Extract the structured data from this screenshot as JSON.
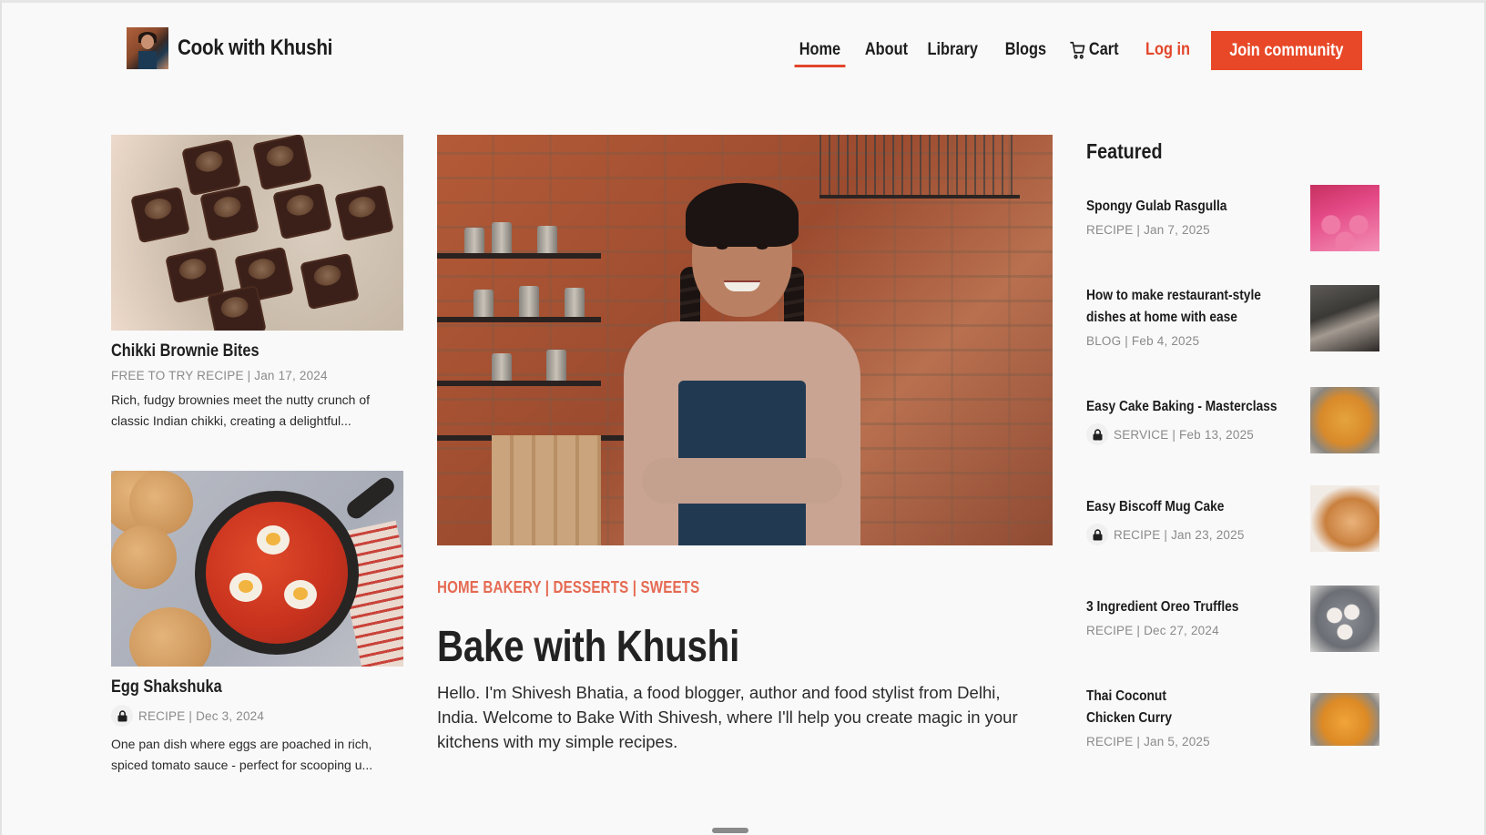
{
  "brand": {
    "name": "Cook with Khushi",
    "logo_icon": "chef-portrait"
  },
  "nav": {
    "items": [
      {
        "label": "Home",
        "active": true
      },
      {
        "label": "About"
      },
      {
        "label": "Library"
      },
      {
        "label": "Blogs"
      }
    ],
    "cart_label": "Cart",
    "cart_icon": "shopping-cart-icon",
    "login_label": "Log in",
    "join_label": "Join community"
  },
  "colors": {
    "accent": "#e84827",
    "tag": "#e56a52",
    "meta": "#8a8a8a",
    "background": "#f9f9f9"
  },
  "left_cards": [
    {
      "title": "Chikki Brownie Bites",
      "meta": "FREE TO TRY RECIPE | Jan 17, 2024",
      "locked": false,
      "description": "Rich, fudgy brownies meet the nutty crunch of classic Indian chikki, creating a delightful...",
      "image": "chikki brownie bites on a plate"
    },
    {
      "title": "Egg Shakshuka",
      "meta": "RECIPE | Dec 3, 2024",
      "locked": true,
      "description": "One pan dish where eggs are poached in rich, spiced tomato sauce - perfect for scooping u...",
      "image": "egg shakshuka in cast iron pan"
    }
  ],
  "hero": {
    "image": "Khushi smiling in kitchen with brick wall",
    "tags": "HOME BAKERY | DESSERTS | SWEETS",
    "title": "Bake with Khushi",
    "description": "Hello. I'm Shivesh Bhatia, a food blogger, author and food stylist from Delhi, India. Welcome to Bake With Shivesh, where I'll help you create magic in your kitchens with my simple recipes."
  },
  "featured": {
    "heading": "Featured",
    "items": [
      {
        "title": "Spongy Gulab Rasgulla",
        "meta": "RECIPE | Jan 7, 2025",
        "locked": false,
        "thumb": "rasgulla"
      },
      {
        "title": "How to make restaurant-style dishes at home with ease",
        "meta": "BLOG | Feb 4, 2025",
        "locked": false,
        "thumb": "cooking"
      },
      {
        "title": "Easy Cake Baking - Masterclass",
        "meta": "SERVICE | Feb 13, 2025",
        "locked": true,
        "thumb": "noodles"
      },
      {
        "title": "Easy Biscoff Mug Cake",
        "meta": "RECIPE | Jan 23, 2025",
        "locked": true,
        "thumb": "mug cake"
      },
      {
        "title": "3 Ingredient Oreo Truffles",
        "meta": "RECIPE | Dec 27, 2024",
        "locked": false,
        "thumb": "truffles"
      },
      {
        "title": "Thai Coconut Chicken Curry",
        "meta": "RECIPE | Jan 5, 2025",
        "locked": false,
        "thumb": "curry"
      }
    ]
  }
}
